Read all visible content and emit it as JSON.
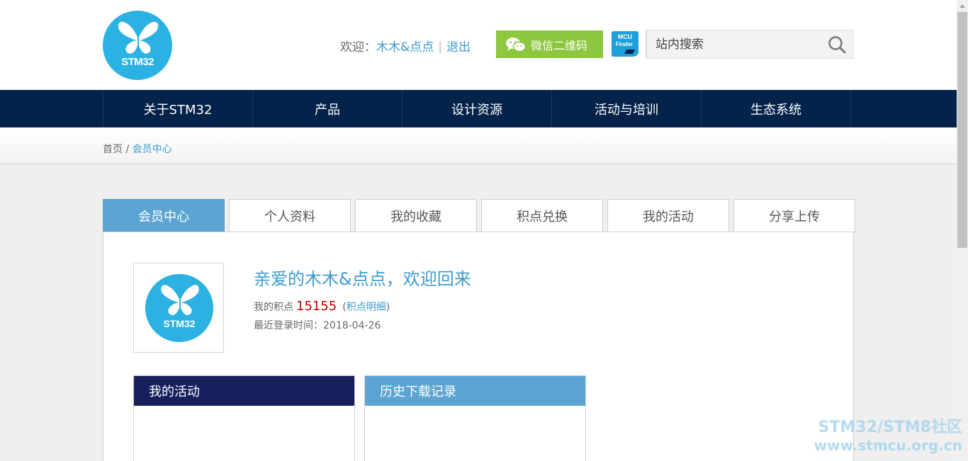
{
  "header": {
    "logo_text": "STM32",
    "welcome_label": "欢迎：",
    "username": "木木&点点",
    "logout_label": "退出",
    "wechat_button": "微信二维码",
    "mcu_finder_line1": "MCU",
    "mcu_finder_line2": "Finder",
    "search_placeholder": "站内搜索"
  },
  "nav": {
    "items": [
      {
        "label": "关于STM32"
      },
      {
        "label": "产品"
      },
      {
        "label": "设计资源"
      },
      {
        "label": "活动与培训"
      },
      {
        "label": "生态系统"
      }
    ]
  },
  "breadcrumb": {
    "home": "首页",
    "separator": "/",
    "current": "会员中心"
  },
  "tabs": [
    {
      "label": "会员中心",
      "active": true
    },
    {
      "label": "个人资料",
      "active": false
    },
    {
      "label": "我的收藏",
      "active": false
    },
    {
      "label": "积点兑换",
      "active": false
    },
    {
      "label": "我的活动",
      "active": false
    },
    {
      "label": "分享上传",
      "active": false
    }
  ],
  "profile": {
    "avatar_text": "STM32",
    "greeting": "亲爱的木木&点点，欢迎回来",
    "points_label": "我的积点",
    "points_value": "15155",
    "points_detail_open": "(",
    "points_detail_link": "积点明细",
    "points_detail_close": ")",
    "last_login_label": "最近登录时间：",
    "last_login_value": "2018-04-26"
  },
  "boxes": {
    "activities_title": "我的活动",
    "downloads_title": "历史下载记录"
  },
  "watermark": {
    "line1": "STM32/STM8社区",
    "line2": "www.stmcu.org.cn"
  },
  "colors": {
    "nav_bg": "#03234b",
    "accent_blue": "#5ca5d2",
    "link_blue": "#3b9bd0",
    "logo_cyan": "#2bb2e3",
    "wechat_green": "#8dc63f",
    "points_red": "#c00000",
    "box_dark": "#141f5c"
  },
  "icons": {
    "logo": "butterfly-icon",
    "wechat": "wechat-icon",
    "mcu_finder": "mcu-finder-icon",
    "search": "search-icon"
  }
}
